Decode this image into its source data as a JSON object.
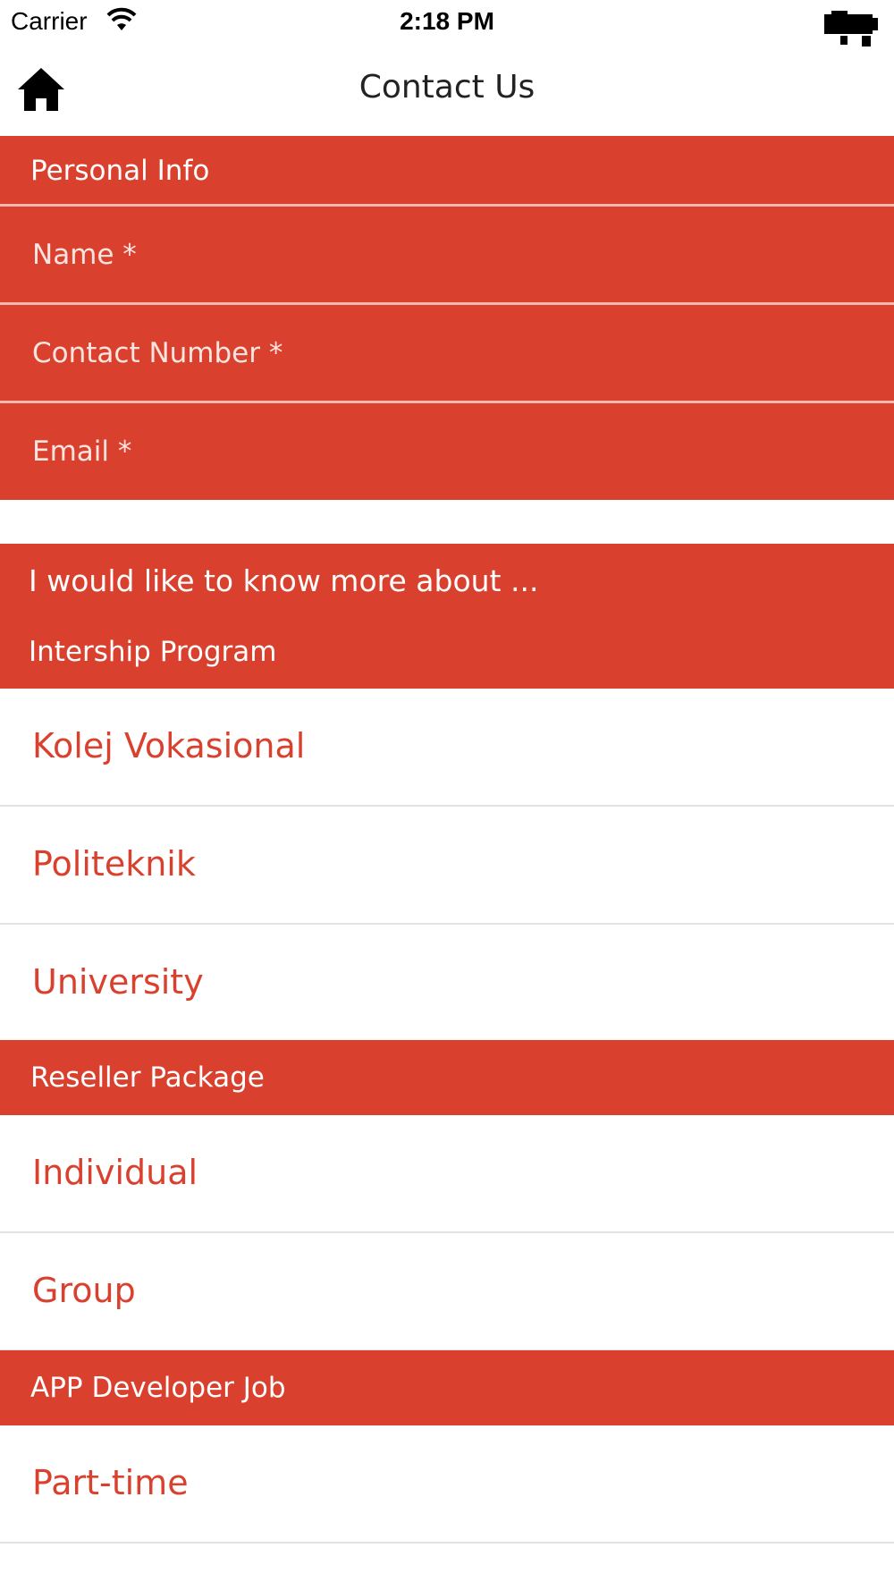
{
  "status_bar": {
    "carrier": "Carrier",
    "time": "2:18 PM"
  },
  "nav": {
    "title": "Contact Us",
    "home_icon": "home-icon"
  },
  "personal_info": {
    "header": "Personal Info",
    "fields": [
      {
        "placeholder": "Name *"
      },
      {
        "placeholder": "Contact Number *"
      },
      {
        "placeholder": "Email *"
      }
    ]
  },
  "interest": {
    "header": "I would like to know more about ...",
    "groups": [
      {
        "title": "Intership Program",
        "options": [
          "Kolej Vokasional",
          "Politeknik",
          "University"
        ]
      },
      {
        "title": "Reseller Package",
        "options": [
          "Individual",
          "Group"
        ]
      },
      {
        "title": "APP Developer Job",
        "options": [
          "Part-time"
        ]
      }
    ]
  },
  "colors": {
    "accent": "#d9412e",
    "divider": "#e3e3e3",
    "background": "#ffffff"
  }
}
